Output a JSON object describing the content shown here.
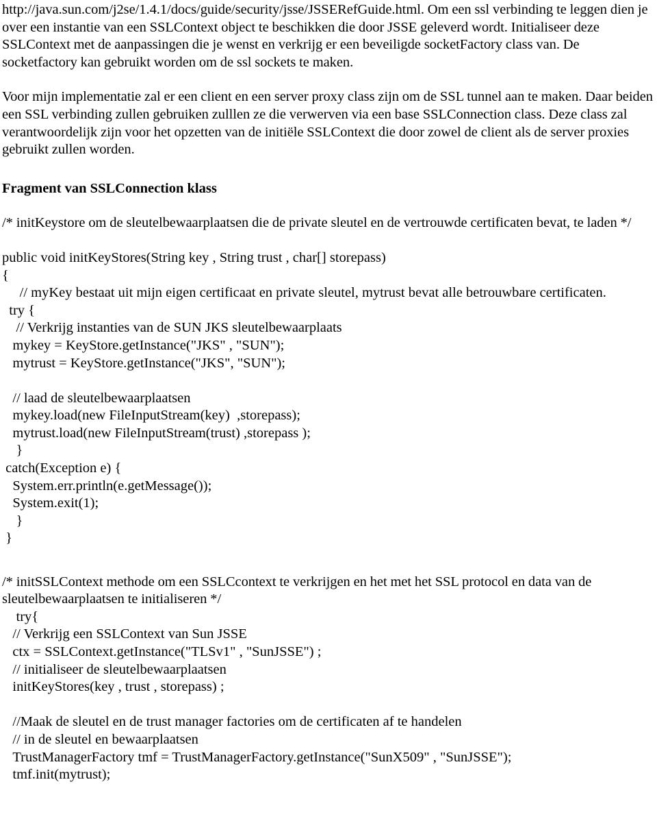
{
  "document": {
    "intro_paragraph": "http://java.sun.com/j2se/1.4.1/docs/guide/security/jsse/JSSERefGuide.html. Om een ssl verbinding te leggen dien je over een instantie van een SSLContext object te beschikken die door JSSE geleverd wordt. Initialiseer deze SSLContext met de aanpassingen die je wenst en verkrijg er een beveiligde socketFactory class van. De socketfactory kan gebruikt worden om de ssl sockets te maken.",
    "url": "http://java.sun.com/j2se/1.4.1/docs/guide/security/jsse/JSSERefGuide.html",
    "second_paragraph": "Voor mijn implementatie zal er een client en een server proxy class zijn om de SSL tunnel aan te maken. Daar beiden een SSL verbinding zullen gebruiken zulllen ze die verwerven via een base SSLConnection class. Deze class zal verantwoordelijk zijn voor het opzetten van de initiële SSLContext die door zowel de client als de server proxies gebruikt zullen worden.",
    "section_heading": "Fragment van SSLConnection klass",
    "comment_initkeystore": "/* initKeystore om de sleutelbewaarplaatsen die de private sleutel en de vertrouwde certificaten bevat, te laden */",
    "code_block_1": [
      "public void initKeyStores(String key , String trust , char[] storepass)",
      "{",
      "     // myKey bestaat uit mijn eigen certificaat en private sleutel, mytrust bevat alle betrouwbare certificaten.",
      "  try {",
      "    // Verkrijg instanties van de SUN JKS sleutelbewaarplaats",
      "   mykey = KeyStore.getInstance(\"JKS\" , \"SUN\");",
      "   mytrust = KeyStore.getInstance(\"JKS\", \"SUN\");",
      "",
      "   // laad de sleutelbewaarplaatsen",
      "   mykey.load(new FileInputStream(key)  ,storepass);",
      "   mytrust.load(new FileInputStream(trust) ,storepass );",
      "    }",
      " catch(Exception e) {",
      "   System.err.println(e.getMessage());",
      "   System.exit(1);",
      "    }",
      " }"
    ],
    "comment_initsslcontext": "/* initSSLContext methode om een SSLCcontext te verkrijgen en het met het SSL protocol en data van de sleutelbewaarplaatsen te initialiseren */",
    "code_block_2": [
      "    try{",
      "   // Verkrijg een SSLContext van Sun JSSE",
      "   ctx = SSLContext.getInstance(\"TLSv1\" , \"SunJSSE\") ;",
      "   // initialiseer de sleutelbewaarplaatsen",
      "   initKeyStores(key , trust , storepass) ;",
      "",
      "   //Maak de sleutel en de trust manager factories om de certificaten af te handelen",
      "   // in de sleutel en bewaarplaatsen",
      "   TrustManagerFactory tmf = TrustManagerFactory.getInstance(\"SunX509\" , \"SunJSSE\");",
      "   tmf.init(mytrust);"
    ]
  },
  "colors": {
    "page_background": "#ffffff",
    "text": "#000000"
  }
}
